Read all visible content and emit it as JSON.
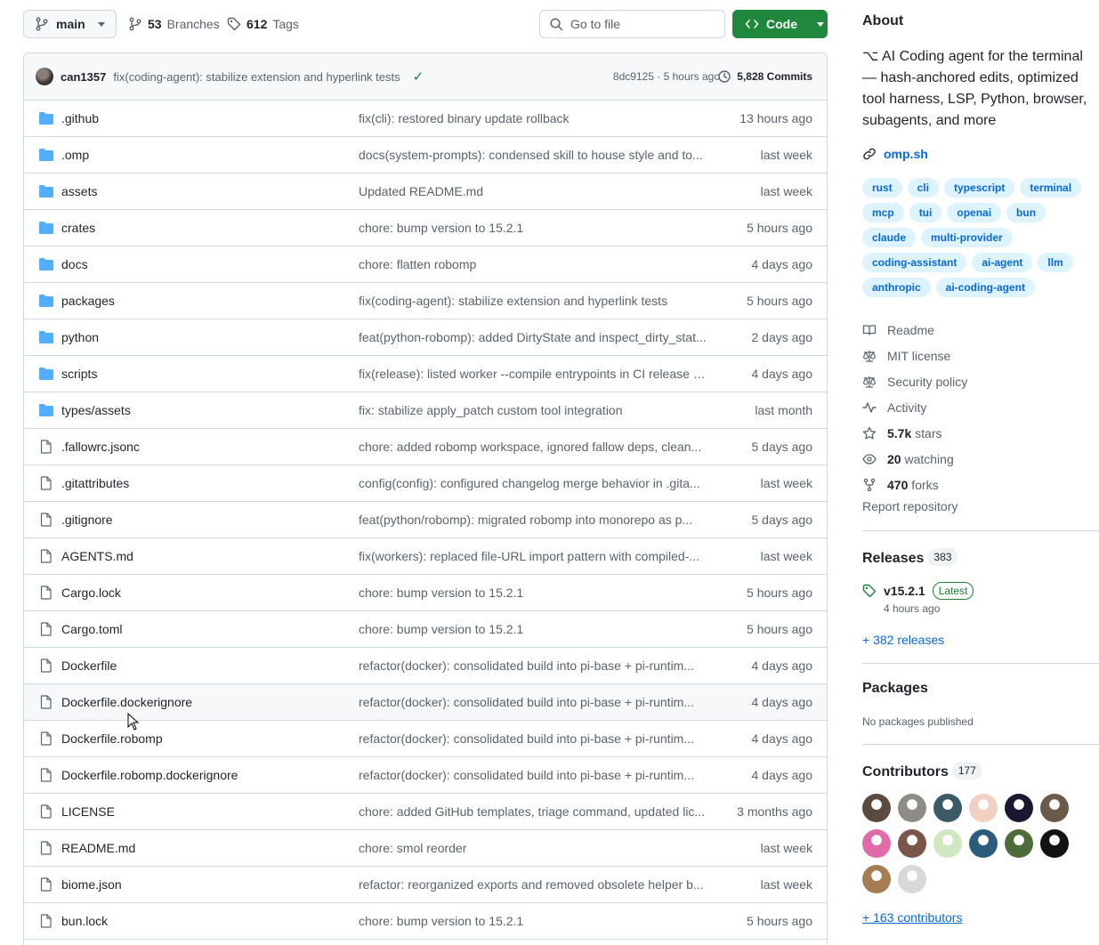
{
  "toolbar": {
    "branch": "main",
    "branches_count": "53",
    "branches_label": "Branches",
    "tags_count": "612",
    "tags_label": "Tags",
    "goto_placeholder": "Go to file",
    "code_label": "Code"
  },
  "latest_commit": {
    "author": "can1357",
    "message": "fix(coding-agent): stabilize extension and hyperlink tests",
    "meta": "8dc9125 · 5 hours ago",
    "commits_count": "5,828 Commits"
  },
  "files": [
    {
      "type": "dir",
      "name": ".github",
      "message": "fix(cli): restored binary update rollback",
      "date": "13 hours ago"
    },
    {
      "type": "dir",
      "name": ".omp",
      "message": "docs(system-prompts): condensed skill to house style and to...",
      "date": "last week"
    },
    {
      "type": "dir",
      "name": "assets",
      "message": "Updated README.md",
      "date": "last week"
    },
    {
      "type": "dir",
      "name": "crates",
      "message": "chore: bump version to 15.2.1",
      "date": "5 hours ago"
    },
    {
      "type": "dir",
      "name": "docs",
      "message": "chore: flatten robomp",
      "date": "4 days ago"
    },
    {
      "type": "dir",
      "name": "packages",
      "message": "fix(coding-agent): stabilize extension and hyperlink tests",
      "date": "5 hours ago"
    },
    {
      "type": "dir",
      "name": "python",
      "message": "feat(python-robomp): added DirtyState and inspect_dirty_stat...",
      "date": "2 days ago"
    },
    {
      "type": "dir",
      "name": "scripts",
      "message": "fix(release): listed worker --compile entrypoints in CI release s...",
      "date": "4 days ago"
    },
    {
      "type": "dir",
      "name": "types/assets",
      "message": "fix: stabilize apply_patch custom tool integration",
      "date": "last month"
    },
    {
      "type": "file",
      "name": ".fallowrc.jsonc",
      "message": "chore: added robomp workspace, ignored fallow deps, clean...",
      "date": "5 days ago"
    },
    {
      "type": "file",
      "name": ".gitattributes",
      "message": "config(config): configured changelog merge behavior in .gita...",
      "date": "last week"
    },
    {
      "type": "file",
      "name": ".gitignore",
      "message": "feat(python/robomp): migrated robomp into monorepo as p...",
      "date": "5 days ago"
    },
    {
      "type": "file",
      "name": "AGENTS.md",
      "message": "fix(workers): replaced file-URL import pattern with compiled-...",
      "date": "last week"
    },
    {
      "type": "file",
      "name": "Cargo.lock",
      "message": "chore: bump version to 15.2.1",
      "date": "5 hours ago"
    },
    {
      "type": "file",
      "name": "Cargo.toml",
      "message": "chore: bump version to 15.2.1",
      "date": "5 hours ago"
    },
    {
      "type": "file",
      "name": "Dockerfile",
      "message": "refactor(docker): consolidated build into pi-base + pi-runtim...",
      "date": "4 days ago"
    },
    {
      "type": "file",
      "name": "Dockerfile.dockerignore",
      "message": "refactor(docker): consolidated build into pi-base + pi-runtim...",
      "date": "4 days ago",
      "hover": true
    },
    {
      "type": "file",
      "name": "Dockerfile.robomp",
      "message": "refactor(docker): consolidated build into pi-base + pi-runtim...",
      "date": "4 days ago"
    },
    {
      "type": "file",
      "name": "Dockerfile.robomp.dockerignore",
      "message": "refactor(docker): consolidated build into pi-base + pi-runtim...",
      "date": "4 days ago"
    },
    {
      "type": "file",
      "name": "LICENSE",
      "message": "chore: added GitHub templates, triage command, updated lic...",
      "date": "3 months ago"
    },
    {
      "type": "file",
      "name": "README.md",
      "message": "chore: smol reorder",
      "date": "last week"
    },
    {
      "type": "file",
      "name": "biome.json",
      "message": "refactor: reorganized exports and removed obsolete helper b...",
      "date": "last week"
    },
    {
      "type": "file",
      "name": "bun.lock",
      "message": "chore: bump version to 15.2.1",
      "date": "5 hours ago"
    }
  ],
  "about": {
    "title": "About",
    "description": "⌥ AI Coding agent for the terminal — hash-anchored edits, optimized tool harness, LSP, Python, browser, subagents, and more",
    "website": "omp.sh",
    "topics": [
      "rust",
      "cli",
      "typescript",
      "terminal",
      "mcp",
      "tui",
      "openai",
      "bun",
      "claude",
      "multi-provider",
      "coding-assistant",
      "ai-agent",
      "llm",
      "anthropic",
      "ai-coding-agent"
    ],
    "readme": "Readme",
    "license": "MIT license",
    "security": "Security policy",
    "activity": "Activity",
    "stars_count": "5.7k",
    "stars_label": "stars",
    "watching_count": "20",
    "watching_label": "watching",
    "forks_count": "470",
    "forks_label": "forks",
    "report": "Report repository"
  },
  "releases": {
    "title": "Releases",
    "count": "383",
    "latest_version": "v15.2.1",
    "latest_badge": "Latest",
    "latest_date": "4 hours ago",
    "more": "+ 382 releases"
  },
  "packages": {
    "title": "Packages",
    "none": "No packages published"
  },
  "contributors": {
    "title": "Contributors",
    "count": "177",
    "more": "+ 163 contributors",
    "avatar_colors": [
      "#5a4a3f",
      "#8f8c88",
      "#3c5a66",
      "#f0d0c0",
      "#1c1730",
      "#6b5a4a",
      "#e26aa8",
      "#7a5548",
      "#cfe8c0",
      "#2d5b7c",
      "#4f6b3a",
      "#121212",
      "#a67c52",
      "#d8d8d8"
    ]
  },
  "colors": {
    "accent": "#0969da",
    "code_button": "#1f883d",
    "folder": "#54aeff",
    "check": "#1a7f37"
  }
}
